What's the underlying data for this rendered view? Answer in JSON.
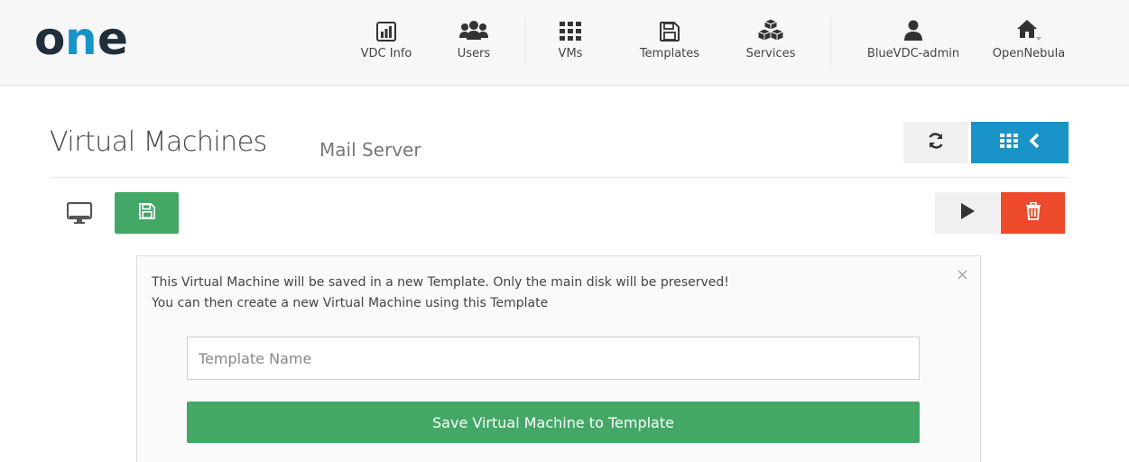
{
  "header": {
    "nav": [
      {
        "label": "VDC Info",
        "icon": "bar-chart-icon"
      },
      {
        "label": "Users",
        "icon": "users-icon"
      },
      {
        "label": "VMs",
        "icon": "grid-icon"
      },
      {
        "label": "Templates",
        "icon": "floppy-disk-icon"
      },
      {
        "label": "Services",
        "icon": "cubes-icon"
      },
      {
        "label": "BlueVDC-admin",
        "icon": "user-icon"
      },
      {
        "label": "OpenNebula",
        "icon": "home-icon"
      }
    ]
  },
  "page": {
    "title": "Virtual Machines",
    "subtitle": "Mail Server"
  },
  "panel": {
    "line1": "This Virtual Machine will be saved in a new Template. Only the main disk will be preserved!",
    "line2": "You can then create a new Virtual Machine using this Template",
    "close_glyph": "×",
    "input_placeholder": "Template Name",
    "input_value": "",
    "save_label": "Save Virtual Machine to Template"
  },
  "colors": {
    "green": "#43a866",
    "blue": "#1a93c8",
    "red": "#ec4a2b"
  }
}
